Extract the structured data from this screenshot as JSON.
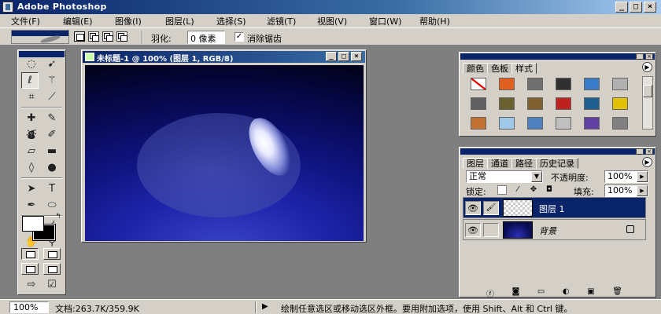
{
  "app": {
    "title": "Adobe Photoshop",
    "min": "_",
    "max": "□",
    "close": "×"
  },
  "menu": [
    "文件(F)",
    "编辑(E)",
    "图像(I)",
    "图层(L)",
    "选择(S)",
    "滤镜(T)",
    "视图(V)",
    "窗口(W)",
    "帮助(H)"
  ],
  "options": {
    "feather_label": "羽化:",
    "feather_value": "0 像素",
    "antialias_check": "✓",
    "antialias_label": "消除锯齿"
  },
  "document": {
    "title": "未标题-1 @ 100% (图层 1, RGB/8)",
    "min": "_",
    "max": "□",
    "close": "×"
  },
  "styles_panel": {
    "tabs": [
      "颜色",
      "色板",
      "样式"
    ],
    "menu_arrow": "▶",
    "swatches": [
      "#ffffff",
      "#e06020",
      "#707070",
      "#303030",
      "#3a7cc8",
      "#b0b0b0",
      "#606060",
      "#6a6030",
      "#806030",
      "#c02020",
      "#206090",
      "#e0c000",
      "#c07030",
      "#a0c8e8",
      "#5080c0",
      "#c0c0c0",
      "#6040a0",
      "#808080"
    ]
  },
  "layers_panel": {
    "tabs": [
      "图层",
      "通道",
      "路径",
      "历史记录"
    ],
    "menu_arrow": "▶",
    "blend_mode": "正常",
    "opacity_label": "不透明度:",
    "opacity_value": "100%",
    "lock_label": "锁定:",
    "fill_label": "填充:",
    "fill_value": "100%",
    "layers": [
      {
        "name": "图层 1",
        "selected": true
      },
      {
        "name": "背景",
        "selected": false
      }
    ]
  },
  "status": {
    "zoom": "100%",
    "doc_info": "文档:263.7K/359.9K",
    "hint": "绘制任意选区或移动选区外框。要用附加选项，使用 Shift、Alt 和 Ctrl 键。"
  },
  "icons": {
    "eye": "👁",
    "brush": "🖌",
    "arrow": "▶",
    "dropdown": "▼"
  }
}
